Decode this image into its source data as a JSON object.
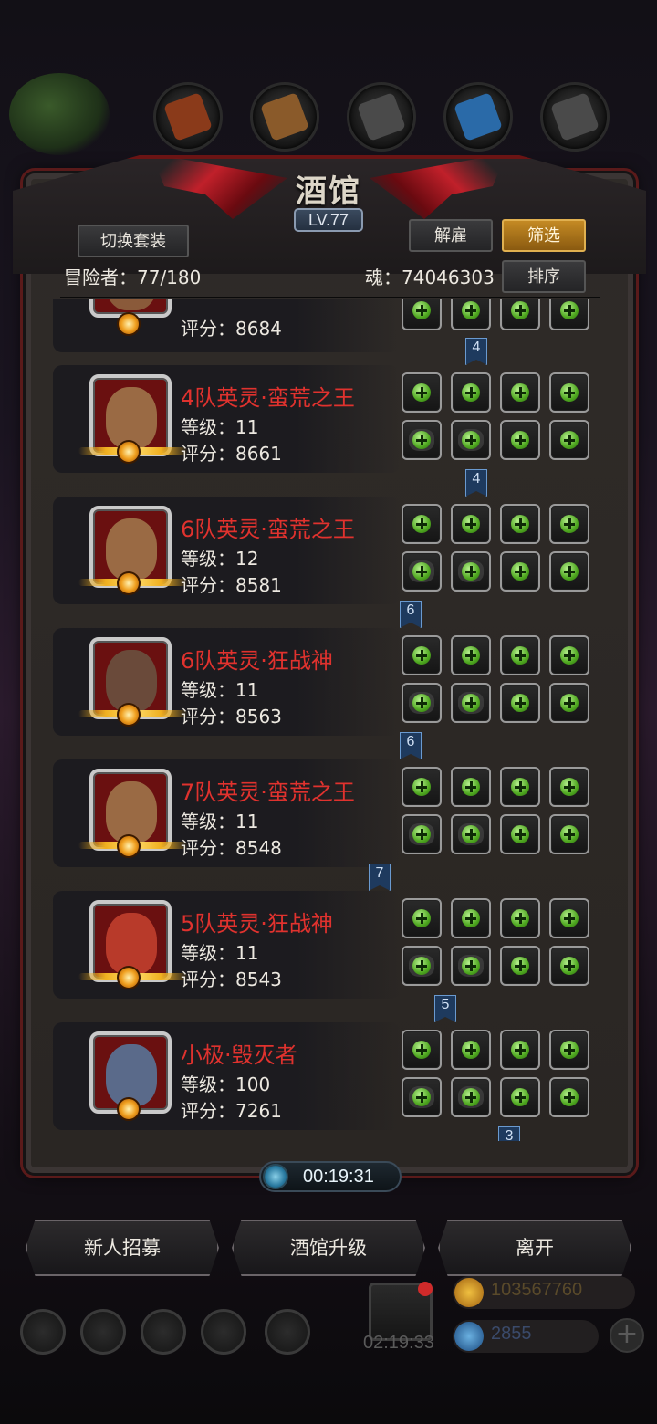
{
  "header": {
    "title": "酒馆",
    "level": "LV.77",
    "switch_label": "切换套装",
    "dismiss_label": "解雇",
    "filter_label": "筛选",
    "sort_label": "排序",
    "adventurers": "冒险者：77/180",
    "soul": "魂：74046303"
  },
  "resources": [
    {
      "icon": "meat-icon",
      "color": "#8a3a1a"
    },
    {
      "icon": "wood-icon",
      "color": "#8a5a2a"
    },
    {
      "icon": "iron-icon",
      "color": "#4a4a4a"
    },
    {
      "icon": "crystal-icon",
      "color": "#2a6aa8"
    },
    {
      "icon": "stone-icon",
      "color": "#4a4a4a"
    }
  ],
  "heroes": [
    {
      "name": "",
      "level": "",
      "score": "评分：8684",
      "face": "#8a5a3a",
      "tag": "4"
    },
    {
      "name": "4队英灵·蛮荒之王",
      "level": "等级：11",
      "score": "评分：8661",
      "face": "#9a6a44",
      "tag": "4"
    },
    {
      "name": "6队英灵·蛮荒之王",
      "level": "等级：12",
      "score": "评分：8581",
      "face": "#9a6a44",
      "tag": "6"
    },
    {
      "name": "6队英灵·狂战神",
      "level": "等级：11",
      "score": "评分：8563",
      "face": "#6a4a3a",
      "tag": "6"
    },
    {
      "name": "7队英灵·蛮荒之王",
      "level": "等级：11",
      "score": "评分：8548",
      "face": "#9a6a44",
      "tag": "7"
    },
    {
      "name": "5队英灵·狂战神",
      "level": "等级：11",
      "score": "评分：8543",
      "face": "#b83a2a",
      "tag": "5"
    },
    {
      "name": "小极·毁灭者",
      "level": "等级：100",
      "score": "评分：7261",
      "face": "#5a6a8a",
      "tag": "3"
    }
  ],
  "timer": "00:19:31",
  "bottom": {
    "recruit_label": "新人招募",
    "upgrade_label": "酒馆升级",
    "leave_label": "离开"
  },
  "gift_timer": "02:19:33",
  "currency": {
    "gold": "103567760",
    "gem": "2855"
  }
}
